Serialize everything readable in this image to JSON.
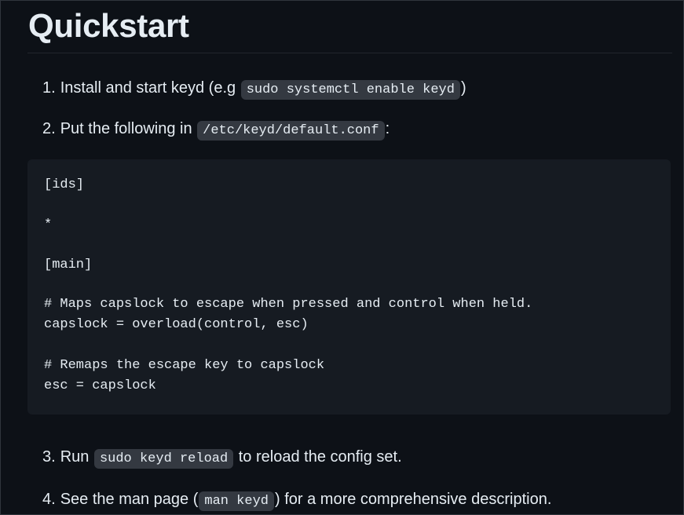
{
  "page": {
    "title": "Quickstart"
  },
  "steps": [
    {
      "num": "1.",
      "before": "Install and start keyd (e.g",
      "code": "sudo systemctl enable keyd",
      "after": ")"
    },
    {
      "num": "2.",
      "before": "Put the following in",
      "code": "/etc/keyd/default.conf",
      "after": ":"
    },
    {
      "num": "3.",
      "before": "Run",
      "code": "sudo keyd reload",
      "after": "to reload the config set."
    },
    {
      "num": "4.",
      "before": "See the man page (",
      "code": "man keyd",
      "after": ") for a more comprehensive description."
    }
  ],
  "config_code": {
    "lines": [
      "[ids]",
      "*",
      "[main]",
      "# Maps capslock to escape when pressed and control when held.",
      "capslock = overload(control, esc)",
      "",
      "# Remaps the escape key to capslock",
      "esc = capslock"
    ]
  },
  "colors": {
    "background": "#0d1117",
    "text": "#e6edf3",
    "code_block_bg": "#161b22",
    "inline_code_bg": "#343941",
    "divider": "#21262d"
  }
}
